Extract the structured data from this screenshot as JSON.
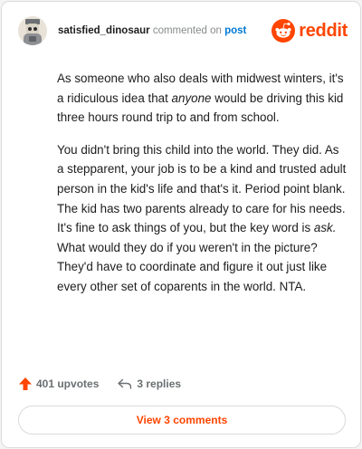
{
  "header": {
    "username": "satisfied_dinosaur",
    "action_text": "commented on",
    "target_text": "post",
    "logo_text": "reddit"
  },
  "comment": {
    "p1_part1": "As someone who also deals with midwest winters, it's a ridiculous idea that ",
    "p1_italic": "anyone",
    "p1_part2": " would be driving this kid three hours round trip to and from school.",
    "p2_part1": "You didn't bring this child into the world. They did. As a stepparent, your job is to be a kind and trusted adult person in the kid's life and that's it. Period point blank. The kid has two parents already to care for his needs. It's fine to ask things of you, but the key word is ",
    "p2_italic": "ask.",
    "p2_part2": " What would they do if you weren't in the picture? They'd have to coordinate and figure it out just like every other set of coparents in the world. NTA."
  },
  "footer": {
    "upvotes": "401 upvotes",
    "replies": "3 replies",
    "view_comments": "View 3 comments"
  },
  "colors": {
    "accent": "#ff4500",
    "link": "#0079d3"
  }
}
